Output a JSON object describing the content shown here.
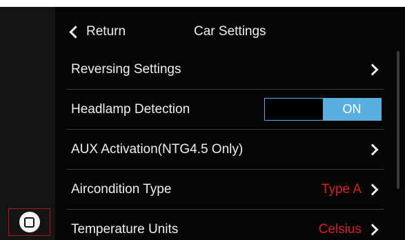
{
  "header": {
    "return_label": "Return",
    "title": "Car Settings"
  },
  "rows": [
    {
      "label": "Reversing Settings",
      "value": ""
    },
    {
      "label": "Headlamp Detection",
      "toggle": {
        "state": "ON",
        "on_label": "ON"
      }
    },
    {
      "label": "AUX Activation(NTG4.5 Only)",
      "value": ""
    },
    {
      "label": "Aircondition Type",
      "value": "Type A"
    },
    {
      "label": "Temperature Units",
      "value": "Celsius"
    }
  ],
  "colors": {
    "accent": "#5aaee0",
    "value_text": "#d42323",
    "highlight_border": "#b01515",
    "background": "#050505"
  },
  "icons": {
    "return": "chevron-left-icon",
    "row_arrow": "chevron-right-icon",
    "home": "home-square-icon"
  }
}
